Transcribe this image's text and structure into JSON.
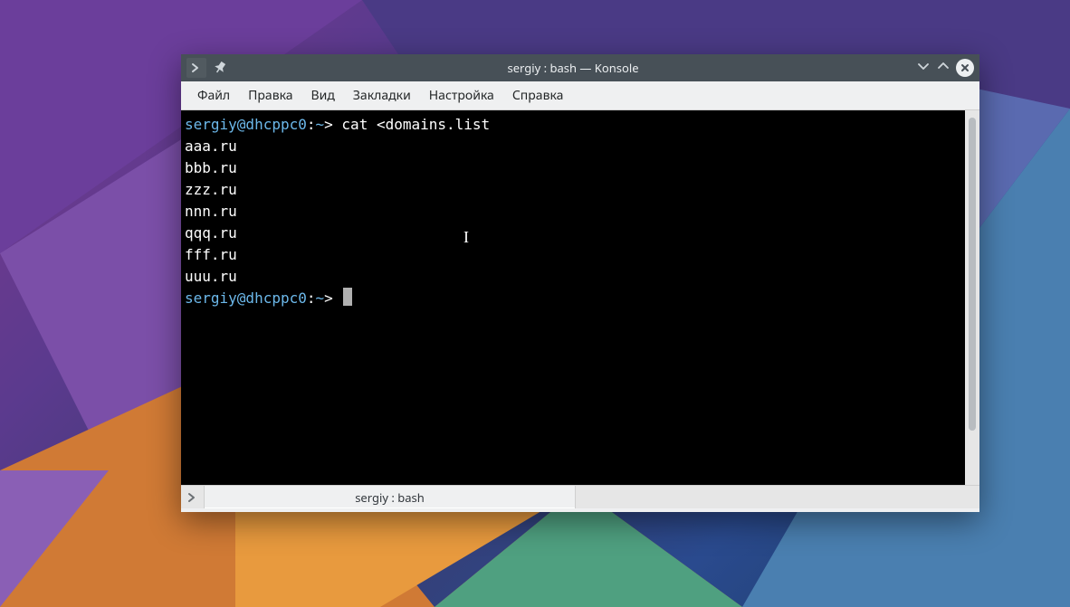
{
  "window": {
    "title": "sergiy : bash — Konsole"
  },
  "menubar": {
    "items": [
      "Файл",
      "Правка",
      "Вид",
      "Закладки",
      "Настройка",
      "Справка"
    ]
  },
  "terminal": {
    "prompt_user": "sergiy@dhcppc0",
    "prompt_path": "~",
    "prompt_suffix": ">",
    "command": "cat <domains.list",
    "output_lines": [
      "aaa.ru",
      "bbb.ru",
      "zzz.ru",
      "nnn.ru",
      "qqq.ru",
      "fff.ru",
      "uuu.ru"
    ]
  },
  "tabs": {
    "active_label": "sergiy : bash"
  }
}
